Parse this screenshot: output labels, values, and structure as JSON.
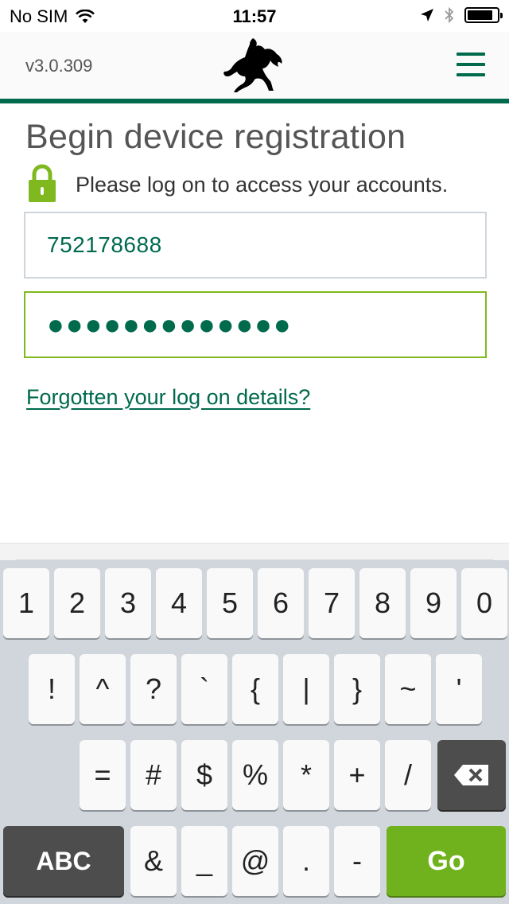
{
  "status_bar": {
    "carrier": "No SIM",
    "time": "11:57",
    "icons": [
      "wifi-icon",
      "location-arrow-icon",
      "bluetooth-icon",
      "battery-icon"
    ],
    "battery_level": 0.85
  },
  "header": {
    "version": "v3.0.309",
    "logo": "black-horse-logo",
    "menu_icon": "hamburger-menu-icon"
  },
  "main": {
    "title": "Begin device registration",
    "lock_icon": "padlock-icon",
    "intro": "Please log on to access your accounts.",
    "user_id_value": "752178688",
    "password_value": "●●●●●●●●●●●●●",
    "forgot_link": "Forgotten your log on details?"
  },
  "keyboard": {
    "row1": [
      "1",
      "2",
      "3",
      "4",
      "5",
      "6",
      "7",
      "8",
      "9",
      "0"
    ],
    "row2": [
      "!",
      "^",
      "?",
      "`",
      "{",
      "|",
      "}",
      "~",
      "'"
    ],
    "row3": [
      "=",
      "#",
      "$",
      "%",
      "*",
      "+",
      "/"
    ],
    "row4": [
      "ABC",
      "&",
      "_",
      "@",
      ".",
      "-",
      "Go"
    ],
    "backspace_icon": "backspace-icon"
  },
  "colors": {
    "brand_green": "#006a4d",
    "accent_green": "#6fb21d",
    "focus_border": "#7fb81f"
  }
}
